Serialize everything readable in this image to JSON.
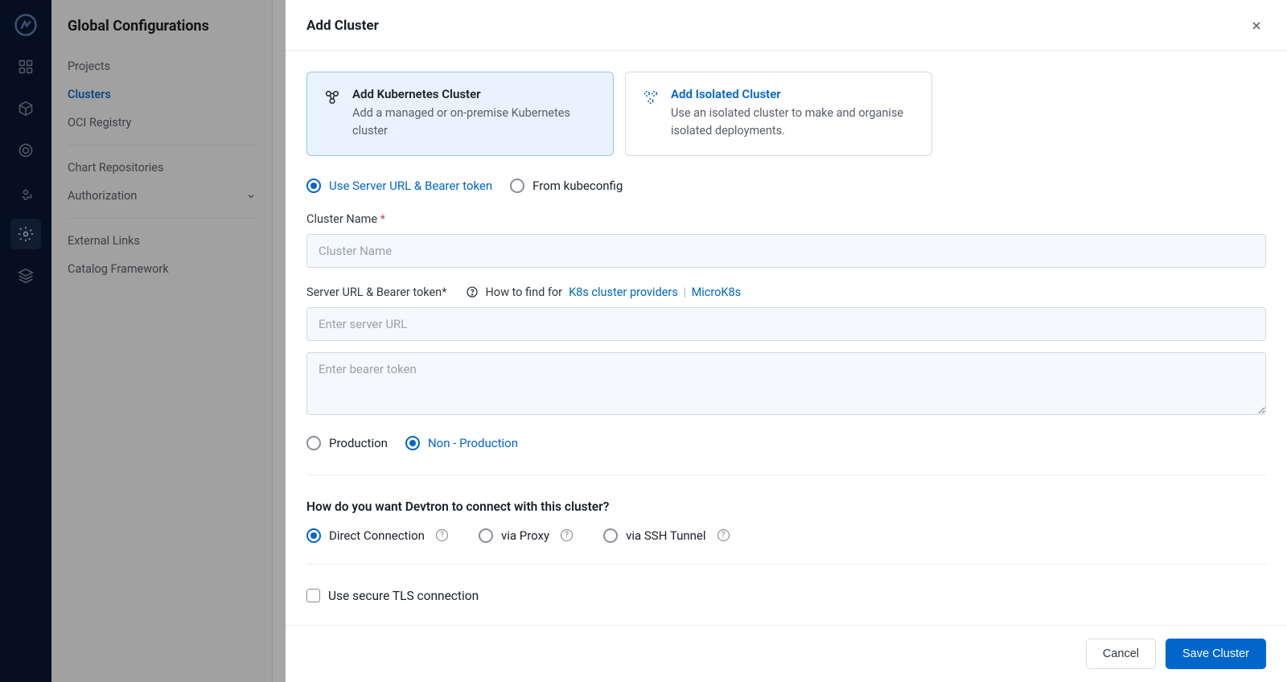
{
  "sidebar": {
    "title": "Global Configurations",
    "items": [
      {
        "label": "Projects"
      },
      {
        "label": "Clusters",
        "active": true
      },
      {
        "label": "OCI Registry"
      }
    ],
    "items2": [
      {
        "label": "Chart Repositories"
      },
      {
        "label": "Authorization",
        "expandable": true
      }
    ],
    "items3": [
      {
        "label": "External Links"
      },
      {
        "label": "Catalog Framework"
      }
    ]
  },
  "drawer": {
    "title": "Add Cluster",
    "cards": {
      "k8s": {
        "title": "Add Kubernetes Cluster",
        "desc": "Add a managed or on-premise Kubernetes cluster"
      },
      "isolated": {
        "title": "Add Isolated Cluster",
        "desc": "Use an isolated cluster to make and organise isolated deployments."
      }
    },
    "auth_method": {
      "server_url": "Use Server URL & Bearer token",
      "kubeconfig": "From kubeconfig"
    },
    "cluster_name": {
      "label": "Cluster Name",
      "placeholder": "Cluster Name"
    },
    "server_section": {
      "label": "Server URL & Bearer token*",
      "help_prefix": "How to find for",
      "link_k8s": "K8s cluster providers",
      "link_microk8s": "MicroK8s",
      "server_placeholder": "Enter server URL",
      "token_placeholder": "Enter bearer token"
    },
    "env_type": {
      "production": "Production",
      "non_production": "Non - Production"
    },
    "connection": {
      "heading": "How do you want Devtron to connect with this cluster?",
      "direct": "Direct Connection",
      "proxy": "via Proxy",
      "ssh": "via SSH Tunnel"
    },
    "tls": {
      "label": "Use secure TLS connection"
    },
    "footer": {
      "cancel": "Cancel",
      "save": "Save Cluster"
    }
  }
}
